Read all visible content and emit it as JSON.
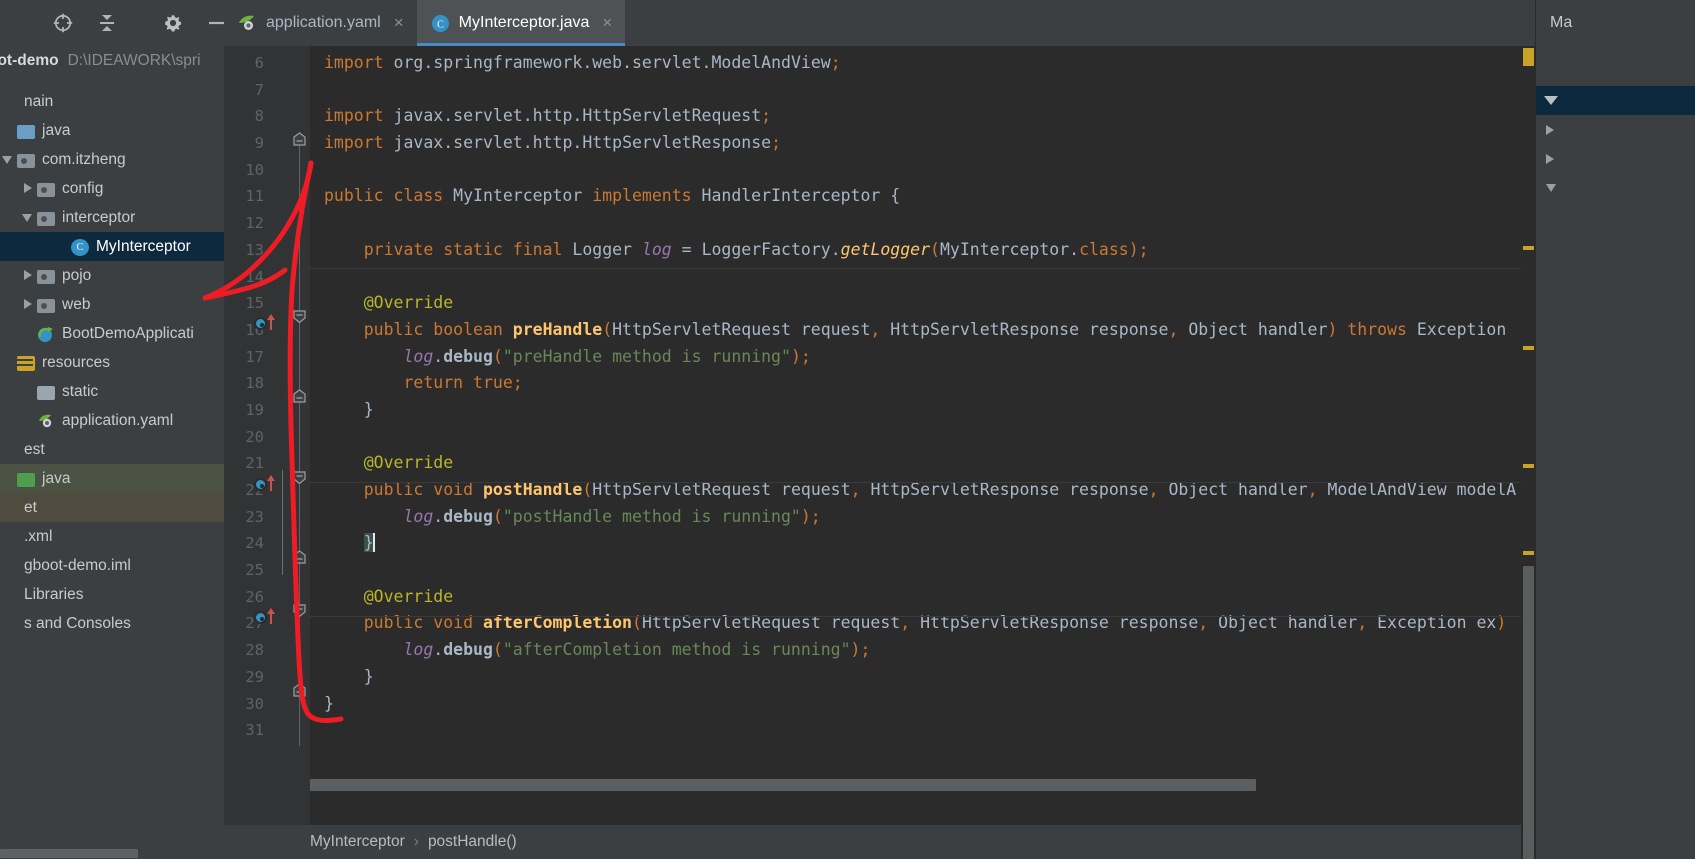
{
  "toolbar": {
    "icons": [
      {
        "name": "locate-icon",
        "label": "Select Opened File"
      },
      {
        "name": "collapse-all-icon",
        "label": "Collapse All"
      },
      {
        "name": "gear-icon",
        "label": "Settings"
      },
      {
        "name": "minimize-icon",
        "label": "Hide"
      }
    ]
  },
  "project": {
    "name": "oot-demo",
    "path": "D:\\IDEAWORK\\spri",
    "tree": [
      {
        "label": "nain",
        "indent": 0,
        "arrow": "none",
        "icon": "none",
        "state": "normal"
      },
      {
        "label": "java",
        "indent": 0,
        "arrow": "none",
        "icon": "module",
        "state": "normal"
      },
      {
        "label": "com.itzheng",
        "indent": 0,
        "arrow": "down",
        "icon": "package",
        "state": "normal"
      },
      {
        "label": "config",
        "indent": 1,
        "arrow": "right",
        "icon": "package",
        "state": "normal"
      },
      {
        "label": "interceptor",
        "indent": 1,
        "arrow": "down",
        "icon": "package",
        "state": "normal"
      },
      {
        "label": "MyInterceptor",
        "indent": 2,
        "arrow": "none",
        "icon": "class",
        "state": "selected"
      },
      {
        "label": "pojo",
        "indent": 1,
        "arrow": "right",
        "icon": "package",
        "state": "normal"
      },
      {
        "label": "web",
        "indent": 1,
        "arrow": "right",
        "icon": "package",
        "state": "normal"
      },
      {
        "label": "BootDemoApplicati",
        "indent": 1,
        "arrow": "none",
        "icon": "spring",
        "state": "normal"
      },
      {
        "label": "resources",
        "indent": 0,
        "arrow": "none",
        "icon": "resources",
        "state": "normal"
      },
      {
        "label": "static",
        "indent": 1,
        "arrow": "none",
        "icon": "folder",
        "state": "normal"
      },
      {
        "label": "application.yaml",
        "indent": 1,
        "arrow": "none",
        "icon": "spring-yaml",
        "state": "normal"
      },
      {
        "label": "est",
        "indent": 0,
        "arrow": "none",
        "icon": "none",
        "state": "normal"
      },
      {
        "label": "java",
        "indent": 0,
        "arrow": "none",
        "icon": "green",
        "state": "green"
      },
      {
        "label": "et",
        "indent": 0,
        "arrow": "none",
        "icon": "none",
        "state": "brown"
      },
      {
        "label": ".xml",
        "indent": 0,
        "arrow": "none",
        "icon": "none",
        "state": "normal"
      },
      {
        "label": "gboot-demo.iml",
        "indent": 0,
        "arrow": "none",
        "icon": "none",
        "state": "normal"
      },
      {
        "label": "Libraries",
        "indent": 0,
        "arrow": "none",
        "icon": "none",
        "state": "normal"
      },
      {
        "label": "s and Consoles",
        "indent": 0,
        "arrow": "none",
        "icon": "none",
        "state": "normal"
      }
    ]
  },
  "tabs": [
    {
      "label": "application.yaml",
      "icon": "spring-yaml-icon",
      "active": false,
      "close": "×"
    },
    {
      "label": "MyInterceptor.java",
      "icon": "java-class-icon",
      "active": true,
      "close": "×"
    }
  ],
  "editor": {
    "first_line_number": 6,
    "lines": [
      {
        "n": 6,
        "text": "import org.springframework.web.servlet.ModelAndView;"
      },
      {
        "n": 7,
        "text": ""
      },
      {
        "n": 8,
        "text": "import javax.servlet.http.HttpServletRequest;"
      },
      {
        "n": 9,
        "text": "import javax.servlet.http.HttpServletResponse;"
      },
      {
        "n": 10,
        "text": ""
      },
      {
        "n": 11,
        "text": "public class MyInterceptor implements HandlerInterceptor {"
      },
      {
        "n": 12,
        "text": ""
      },
      {
        "n": 13,
        "text": "    private static final Logger log = LoggerFactory.getLogger(MyInterceptor.class);"
      },
      {
        "n": 14,
        "text": ""
      },
      {
        "n": 15,
        "text": "    @Override"
      },
      {
        "n": 16,
        "text": "    public boolean preHandle(HttpServletRequest request, HttpServletResponse response, Object handler) throws Exception"
      },
      {
        "n": 17,
        "text": "        log.debug(\"preHandle method is running\");"
      },
      {
        "n": 18,
        "text": "        return true;"
      },
      {
        "n": 19,
        "text": "    }"
      },
      {
        "n": 20,
        "text": ""
      },
      {
        "n": 21,
        "text": "    @Override"
      },
      {
        "n": 22,
        "text": "    public void postHandle(HttpServletRequest request, HttpServletResponse response, Object handler, ModelAndView modelA"
      },
      {
        "n": 23,
        "text": "        log.debug(\"postHandle method is running\");"
      },
      {
        "n": 24,
        "text": "    }"
      },
      {
        "n": 25,
        "text": ""
      },
      {
        "n": 26,
        "text": "    @Override"
      },
      {
        "n": 27,
        "text": "    public void afterCompletion(HttpServletRequest request, HttpServletResponse response, Object handler, Exception ex)"
      },
      {
        "n": 28,
        "text": "        log.debug(\"afterCompletion method is running\");"
      },
      {
        "n": 29,
        "text": "    }"
      },
      {
        "n": 30,
        "text": "}"
      },
      {
        "n": 31,
        "text": ""
      }
    ]
  },
  "breadcrumb": {
    "items": [
      "MyInterceptor",
      "postHandle()"
    ],
    "separator": "›"
  },
  "right_panel": {
    "title": "Ma"
  },
  "colors": {
    "keyword": "#cc7832",
    "string": "#6a8759",
    "annotation": "#bbb529",
    "method": "#ffc66d",
    "field": "#9876aa",
    "text": "#a9b7c6",
    "editor_bg": "#2b2b2b",
    "gutter_bg": "#313335",
    "panel_bg": "#3c3f41",
    "selection": "#0d293e",
    "tab_active_underline": "#4a88c7",
    "annotation_pen": "#ee1c25",
    "warning_marker": "#c9a227"
  }
}
